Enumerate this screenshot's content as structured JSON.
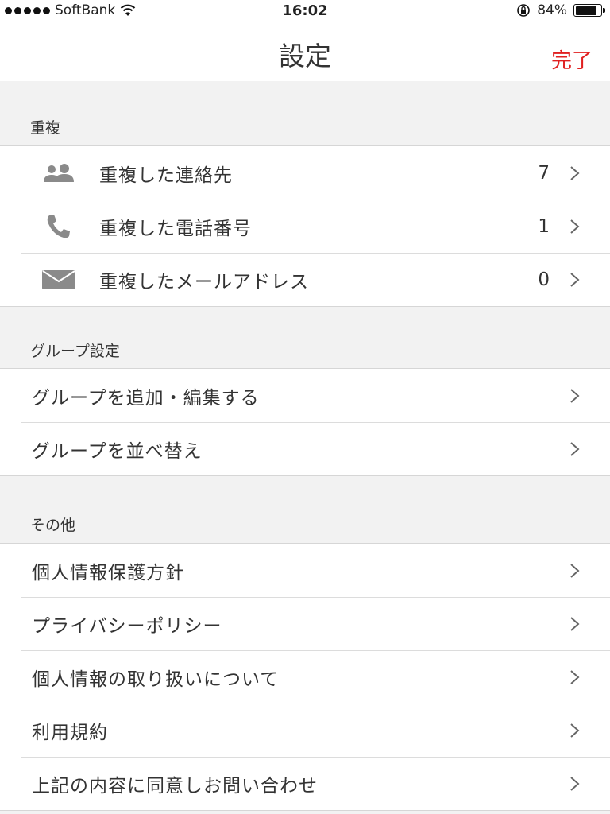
{
  "status_bar": {
    "carrier": "SoftBank",
    "time": "16:02",
    "battery": "84%",
    "battery_level": 0.84
  },
  "nav": {
    "title": "設定",
    "done_label": "完了",
    "done_color": "#e02020"
  },
  "sections": [
    {
      "header": "重複",
      "rows": [
        {
          "label": "重複した連絡先",
          "count": "7",
          "icon": "people-icon"
        },
        {
          "label": "重複した電話番号",
          "count": "1",
          "icon": "phone-icon"
        },
        {
          "label": "重複したメールアドレス",
          "count": "0",
          "icon": "envelope-icon"
        }
      ]
    },
    {
      "header": "グループ設定",
      "rows": [
        {
          "label": "グループを追加・編集する"
        },
        {
          "label": "グループを並べ替え"
        }
      ]
    },
    {
      "header": "その他",
      "rows": [
        {
          "label": "個人情報保護方針"
        },
        {
          "label": "プライバシーポリシー"
        },
        {
          "label": "個人情報の取り扱いについて"
        },
        {
          "label": "利用規約"
        },
        {
          "label": "上記の内容に同意しお問い合わせ"
        }
      ]
    }
  ]
}
